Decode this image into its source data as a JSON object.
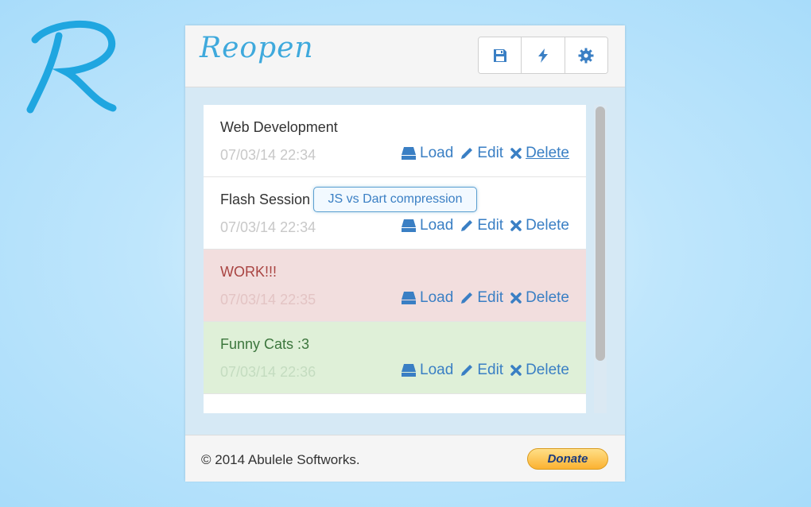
{
  "app": {
    "title": "Reopen"
  },
  "toolbar": {
    "buttons": [
      {
        "name": "save",
        "icon": "floppy-disk-icon"
      },
      {
        "name": "flash",
        "icon": "lightning-bolt-icon"
      },
      {
        "name": "settings",
        "icon": "gear-icon"
      }
    ]
  },
  "sessions": [
    {
      "name": "Web Development",
      "date": "07/03/14 22:34",
      "state": "default"
    },
    {
      "name": "Flash Session",
      "date": "07/03/14 22:34",
      "state": "default"
    },
    {
      "name": "WORK!!!",
      "date": "07/03/14 22:35",
      "state": "danger"
    },
    {
      "name": "Funny Cats :3",
      "date": "07/03/14 22:36",
      "state": "success"
    }
  ],
  "actions": {
    "load": "Load",
    "edit": "Edit",
    "delete": "Delete"
  },
  "tooltip": {
    "text": "JS vs Dart compression"
  },
  "footer": {
    "copyright": "© 2014 Abulele Softworks.",
    "donate": "Donate"
  },
  "colors": {
    "accent": "#3a7fc4",
    "danger_bg": "#f2dede",
    "danger_text": "#a94442",
    "success_bg": "#dff0d8",
    "success_text": "#3c763d",
    "date_text": "#c8c8c8"
  }
}
